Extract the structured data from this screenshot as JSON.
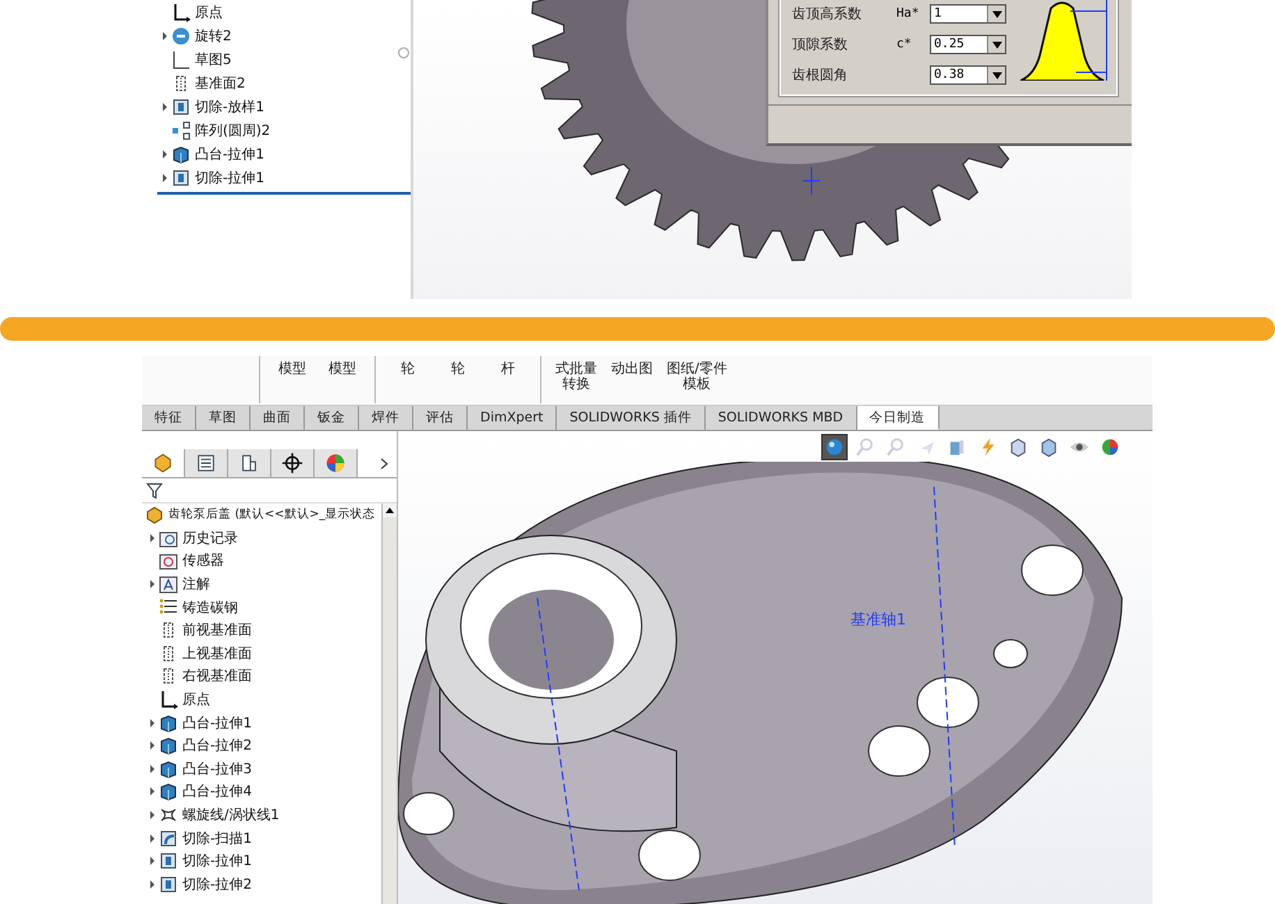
{
  "top_tree": {
    "items": [
      {
        "label": "原点",
        "kind": "origin",
        "expandable": false
      },
      {
        "label": "旋转2",
        "kind": "revolve",
        "expandable": true
      },
      {
        "label": "草图5",
        "kind": "sketch",
        "expandable": false
      },
      {
        "label": "基准面2",
        "kind": "plane",
        "expandable": false
      },
      {
        "label": "切除-放样1",
        "kind": "cut",
        "expandable": true
      },
      {
        "label": "阵列(圆周)2",
        "kind": "pattern",
        "expandable": false
      },
      {
        "label": "凸台-拉伸1",
        "kind": "boss",
        "expandable": true
      },
      {
        "label": "切除-拉伸1",
        "kind": "cut",
        "expandable": true
      }
    ]
  },
  "gear_dialog": {
    "rows": [
      {
        "label": "齿顶高系数",
        "symbol": "Ha*",
        "value": "1"
      },
      {
        "label": "顶隙系数",
        "symbol": "c*",
        "value": "0.25"
      },
      {
        "label": "齿根圆角",
        "value": "0.38"
      }
    ]
  },
  "ribbon": {
    "groups": [
      {
        "items": [
          {
            "lines": [
              "模型"
            ]
          },
          {
            "lines": [
              "模型"
            ]
          }
        ]
      },
      {
        "items": [
          {
            "lines": [
              "轮"
            ]
          },
          {
            "lines": [
              "轮"
            ]
          },
          {
            "lines": [
              "杆"
            ]
          }
        ]
      },
      {
        "items": [
          {
            "lines": [
              "式批量",
              "转换"
            ]
          },
          {
            "lines": [
              "动出图"
            ]
          },
          {
            "lines": [
              "图纸/零件",
              "模板"
            ]
          }
        ]
      }
    ]
  },
  "tabs": [
    {
      "label": "特征",
      "selected": false
    },
    {
      "label": "草图",
      "selected": false
    },
    {
      "label": "曲面",
      "selected": false
    },
    {
      "label": "钣金",
      "selected": false
    },
    {
      "label": "焊件",
      "selected": false
    },
    {
      "label": "评估",
      "selected": false
    },
    {
      "label": "DimXpert",
      "selected": false
    },
    {
      "label": "SOLIDWORKS 插件",
      "selected": false
    },
    {
      "label": "SOLIDWORKS MBD",
      "selected": false
    },
    {
      "label": "今日制造",
      "selected": true
    }
  ],
  "panel_tabs": [
    {
      "kind": "part",
      "selected": true
    },
    {
      "kind": "list",
      "selected": false
    },
    {
      "kind": "config",
      "selected": false
    },
    {
      "kind": "crosshair",
      "selected": false
    },
    {
      "kind": "appearance",
      "selected": false
    }
  ],
  "tree": {
    "root": "齿轮泵后盖 (默认<<默认>_显示状态",
    "items": [
      {
        "label": "历史记录",
        "kind": "history",
        "expandable": true
      },
      {
        "label": "传感器",
        "kind": "sensor",
        "expandable": false
      },
      {
        "label": "注解",
        "kind": "annotation",
        "expandable": true
      },
      {
        "label": "铸造碳钢",
        "kind": "material",
        "expandable": false
      },
      {
        "label": "前视基准面",
        "kind": "plane",
        "expandable": false
      },
      {
        "label": "上视基准面",
        "kind": "plane",
        "expandable": false
      },
      {
        "label": "右视基准面",
        "kind": "plane",
        "expandable": false
      },
      {
        "label": "原点",
        "kind": "origin",
        "expandable": false
      },
      {
        "label": "凸台-拉伸1",
        "kind": "boss",
        "expandable": true
      },
      {
        "label": "凸台-拉伸2",
        "kind": "boss",
        "expandable": true
      },
      {
        "label": "凸台-拉伸3",
        "kind": "boss",
        "expandable": true
      },
      {
        "label": "凸台-拉伸4",
        "kind": "boss",
        "expandable": true
      },
      {
        "label": "螺旋线/涡状线1",
        "kind": "helix",
        "expandable": true
      },
      {
        "label": "切除-扫描1",
        "kind": "sweep",
        "expandable": true
      },
      {
        "label": "切除-拉伸1",
        "kind": "cut",
        "expandable": true
      },
      {
        "label": "切除-拉伸2",
        "kind": "cut",
        "expandable": true
      }
    ]
  },
  "view_toolbar": [
    {
      "kind": "sphere",
      "selected": true
    },
    {
      "kind": "magnifier",
      "selected": false
    },
    {
      "kind": "magnifier",
      "selected": false
    },
    {
      "kind": "arrow",
      "selected": false
    },
    {
      "kind": "section",
      "selected": false
    },
    {
      "kind": "lightning",
      "selected": false
    },
    {
      "kind": "box",
      "selected": false
    },
    {
      "kind": "cube",
      "selected": false
    },
    {
      "kind": "eye",
      "selected": false
    },
    {
      "kind": "pie",
      "selected": false
    }
  ],
  "axis_label": "基准轴1"
}
